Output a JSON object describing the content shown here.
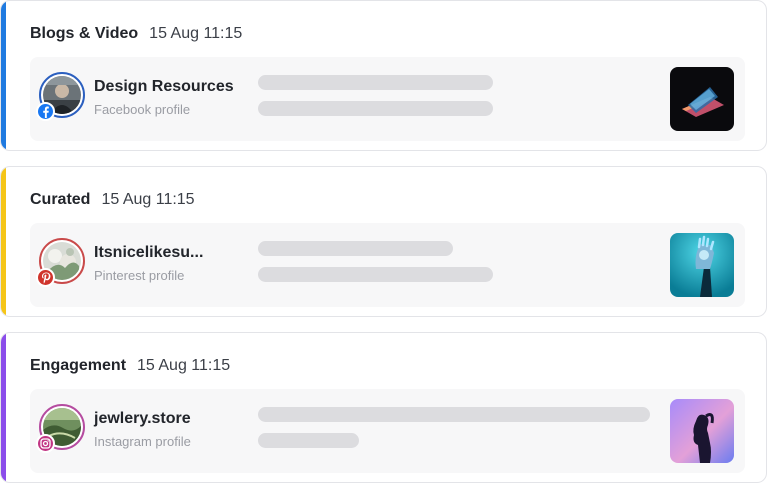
{
  "feed": [
    {
      "title": "Blogs & Video",
      "time": "15 Aug 11:15",
      "accent_color": "#1f7ae0",
      "network": "facebook",
      "network_color": "#1877f2",
      "avatar_ring_color": "#2b5fbf",
      "profile_name": "Design Resources",
      "profile_type": "Facebook profile",
      "thumbnail": "laptop-image"
    },
    {
      "title": "Curated",
      "time": "15 Aug 11:15",
      "accent_color": "#f5c518",
      "network": "pinterest",
      "network_color": "#d0342c",
      "avatar_ring_color": "#c94a4a",
      "profile_name": "Itsnicelikesu...",
      "profile_type": "Pinterest profile",
      "thumbnail": "robot-hand-image"
    },
    {
      "title": "Engagement",
      "time": "15 Aug 11:15",
      "accent_color": "#8b4dea",
      "network": "instagram",
      "network_color": "#c13584",
      "avatar_ring_color": "#b54ca0",
      "profile_name": "jewlery.store",
      "profile_type": "Instagram profile",
      "thumbnail": "silhouette-image"
    }
  ]
}
